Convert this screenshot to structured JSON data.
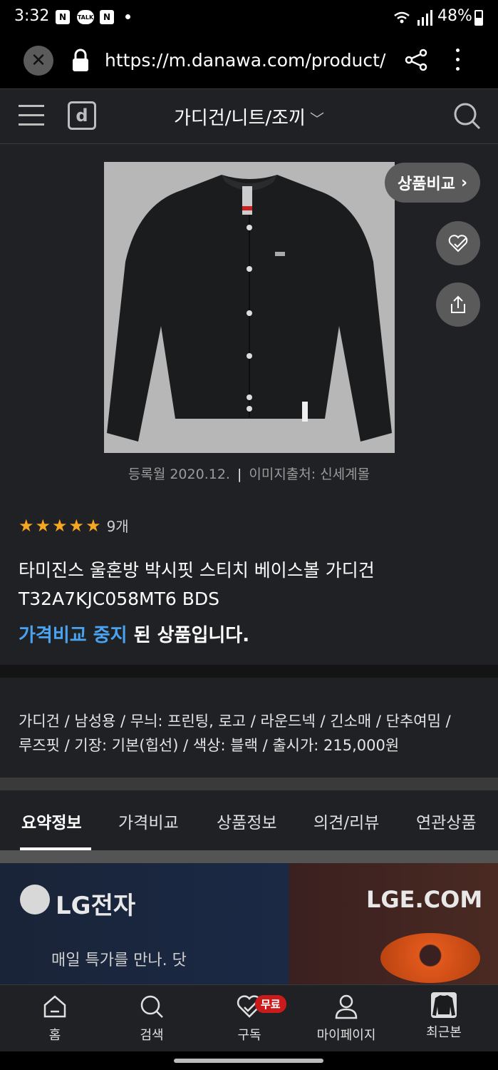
{
  "status_bar": {
    "time": "3:32",
    "notif_icons": [
      "N",
      "TALK",
      "N"
    ],
    "battery": "48%"
  },
  "browser": {
    "url": "https://m.danawa.com/product/product"
  },
  "header": {
    "logo": "d",
    "category_title": "가디건/니트/조끼"
  },
  "product": {
    "compare_label": "상품비교",
    "caption_date": "등록월 2020.12.",
    "caption_source": "이미지출처: 신세계몰",
    "rating_stars": 5,
    "review_count": "9개",
    "name_line1": "타미진스 울혼방 박시핏 스티치 베이스볼 가디건",
    "name_line2": "T32A7KJC058MT6 BDS",
    "status_accent": "가격비교 중지",
    "status_rest": " 된 상품입니다.",
    "specs_line1": "가디건 / 남성용 / 무늬: 프린팅, 로고 / 라운드넥 / 긴소매 / 단추여밈 /",
    "specs_line2": "루즈핏 / 기장: 기본(힙선) / 색상: 블랙 / 출시가: 215,000원"
  },
  "tabs": [
    {
      "label": "요약정보",
      "active": true
    },
    {
      "label": "가격비교",
      "active": false
    },
    {
      "label": "상품정보",
      "active": false
    },
    {
      "label": "의견/리뷰",
      "active": false
    },
    {
      "label": "연관상품",
      "active": false
    }
  ],
  "banner": {
    "brand": "LG전자",
    "site": "LGE.COM",
    "tagline": "매일 특가를 만나. 닷"
  },
  "bottom_nav": {
    "home": "홈",
    "search": "검색",
    "subscribe": "구독",
    "badge": "무료",
    "mypage": "마이페이지",
    "recent": "최근본"
  },
  "colors": {
    "accent": "#4aa3f0",
    "star": "#f5a623",
    "badge": "#c91b1b",
    "background": "#202124"
  }
}
